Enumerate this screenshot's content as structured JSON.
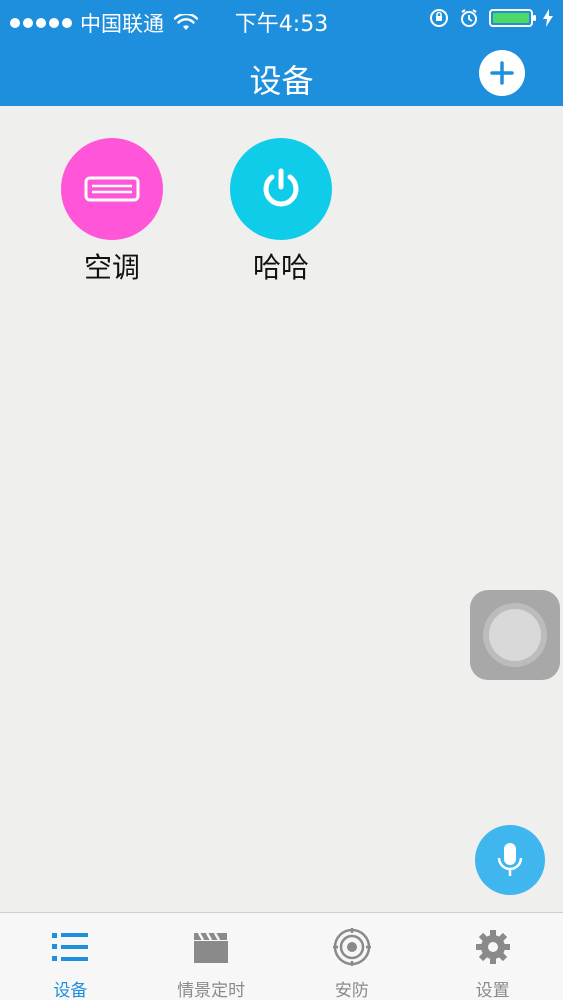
{
  "status_bar": {
    "carrier": "中国联通",
    "time": "下午4:53"
  },
  "nav": {
    "title": "设备"
  },
  "devices": [
    {
      "label": "空调",
      "color": "#ff55d8",
      "icon": "air-conditioner-icon"
    },
    {
      "label": "哈哈",
      "color": "#0fcde9",
      "icon": "power-icon"
    }
  ],
  "tabs": [
    {
      "label": "设备",
      "icon": "list-icon",
      "active": true
    },
    {
      "label": "情景定时",
      "icon": "clapperboard-icon",
      "active": false
    },
    {
      "label": "安防",
      "icon": "security-icon",
      "active": false
    },
    {
      "label": "设置",
      "icon": "gear-icon",
      "active": false
    }
  ],
  "colors": {
    "header": "#1e8fdd",
    "background": "#efefed",
    "mic": "#3fb7ee",
    "active_tab": "#1e8fdd",
    "inactive_tab": "#8a8a8a"
  }
}
